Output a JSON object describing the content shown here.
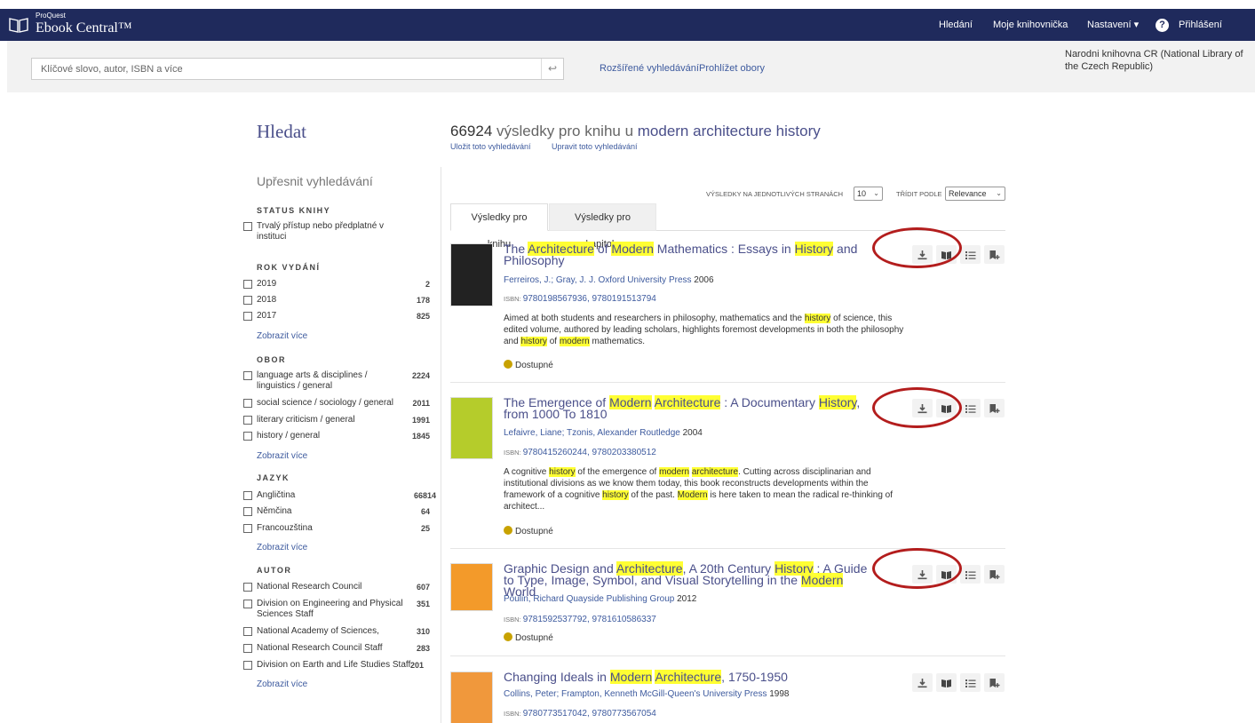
{
  "header": {
    "logo_top": "ProQuest",
    "logo_main": "Ebook Central™",
    "nav": {
      "search": "Hledání",
      "bookshelf": "Moje knihovnička",
      "settings": "Nastavení ▾",
      "help": "?",
      "login": "Přihlášení"
    }
  },
  "search": {
    "placeholder": "Klíčové slovo, autor, ISBN a více",
    "value": "",
    "advanced": "Rozšířené vyhledávání",
    "browse": "Prohlížet obory",
    "library": "Narodni knihovna CR (National Library of the Czech Republic)"
  },
  "sidebar": {
    "title": "Hledat",
    "refine": "Upřesnit vyhledávání",
    "status": {
      "heading": "STATUS KNIHY",
      "items": [
        {
          "label": "Trvalý přístup nebo předplatné v instituci",
          "count": ""
        }
      ]
    },
    "year": {
      "heading": "ROK VYDÁNÍ",
      "items": [
        {
          "label": "2019",
          "count": "2"
        },
        {
          "label": "2018",
          "count": "178"
        },
        {
          "label": "2017",
          "count": "825"
        }
      ],
      "more": "Zobrazit více"
    },
    "subject": {
      "heading": "OBOR",
      "items": [
        {
          "label": "language arts & disciplines / linguistics / general",
          "count": "2224"
        },
        {
          "label": "social science / sociology / general",
          "count": "2011"
        },
        {
          "label": "literary criticism / general",
          "count": "1991"
        },
        {
          "label": "history / general",
          "count": "1845"
        }
      ],
      "more": "Zobrazit více"
    },
    "language": {
      "heading": "JAZYK",
      "items": [
        {
          "label": "Angličtina",
          "count": "66814"
        },
        {
          "label": "Němčina",
          "count": "64"
        },
        {
          "label": "Francouzština",
          "count": "25"
        }
      ],
      "more": "Zobrazit více"
    },
    "author": {
      "heading": "AUTOR",
      "items": [
        {
          "label": "National Research Council",
          "count": "607"
        },
        {
          "label": "Division on Engineering and Physical Sciences Staff",
          "count": "351"
        },
        {
          "label": "National Academy of Sciences,",
          "count": "310"
        },
        {
          "label": "National Research Council Staff",
          "count": "283"
        },
        {
          "label": "Division on Earth and Life Studies Staff",
          "count": "201"
        }
      ],
      "more": "Zobrazit více"
    }
  },
  "results": {
    "count": "66924",
    "count_text": " výsledky pro knihu u ",
    "query": "modern architecture history",
    "save": "Uložit toto vyhledávání",
    "edit": "Upravit toto vyhledávání",
    "per_page_label": "VÝSLEDKY NA JEDNOTLIVÝCH STRANÁCH",
    "per_page": "10",
    "sort_label": "TŘÍDIT PODLE",
    "sort": "Relevance",
    "tabs": [
      "Výsledky pro knihu",
      "Výsledky pro kapitolu"
    ],
    "isbn_label": "ISBN:",
    "items": [
      {
        "title_parts": [
          "The ",
          "Architecture",
          " of ",
          "Modern",
          " Mathematics : Essays in ",
          "History",
          " and Philosophy"
        ],
        "authors": "Ferreiros, J.; Gray, J. J.  Oxford University Press",
        "year": "2006",
        "isbn": "9780198567936, 9780191513794",
        "desc_parts": [
          "Aimed at both students and researchers in philosophy, mathematics and the ",
          "history",
          " of science, this edited volume, authored by leading scholars, highlights foremost developments in both the philosophy and ",
          "history",
          " of ",
          "modern",
          " mathematics."
        ],
        "status": "Dostupné",
        "cover_color": "#222222"
      },
      {
        "title_parts": [
          "The Emergence of ",
          "Modern",
          " ",
          "Architecture",
          " : A Documentary ",
          "History",
          ", from 1000 To 1810"
        ],
        "authors": "Lefaivre, Liane; Tzonis, Alexander  Routledge",
        "year": "2004",
        "isbn": "9780415260244, 9780203380512",
        "desc_parts": [
          "A cognitive ",
          "history",
          " of the emergence of ",
          "modern",
          " ",
          "architecture",
          ". Cutting across disciplinarian and institutional divisions as we know them today, this book reconstructs developments within the framework of a cognitive ",
          "history",
          " of the past. ",
          "Modern",
          " is here taken to mean the radical re-thinking of architect..."
        ],
        "status": "Dostupné",
        "cover_color": "#b5cc2b"
      },
      {
        "title_parts": [
          "Graphic Design and ",
          "Architecture",
          ", A 20th Century ",
          "History",
          " : A Guide to Type, Image, Symbol, and Visual Storytelling in the ",
          "Modern",
          " World"
        ],
        "authors": "Poulin, Richard  Quayside Publishing Group",
        "year": "2012",
        "isbn": "9781592537792, 9781610586337",
        "desc_parts": [],
        "status": "Dostupné",
        "cover_color": "#f39a2a"
      },
      {
        "title_parts": [
          "Changing Ideals in ",
          "Modern",
          " ",
          "Architecture",
          ", 1750-1950"
        ],
        "authors": "Collins, Peter; Frampton, Kenneth  McGill-Queen's University Press",
        "year": "1998",
        "isbn": "9780773517042, 9780773567054",
        "desc_parts": [],
        "status": "",
        "cover_color": "#f0983c"
      }
    ]
  },
  "colors": {
    "header_bg": "#1f2a5c",
    "link": "#3d5a9e",
    "title": "#4a4f8a",
    "highlight": "#ffff33",
    "annotation_ring": "#b31d1d"
  }
}
